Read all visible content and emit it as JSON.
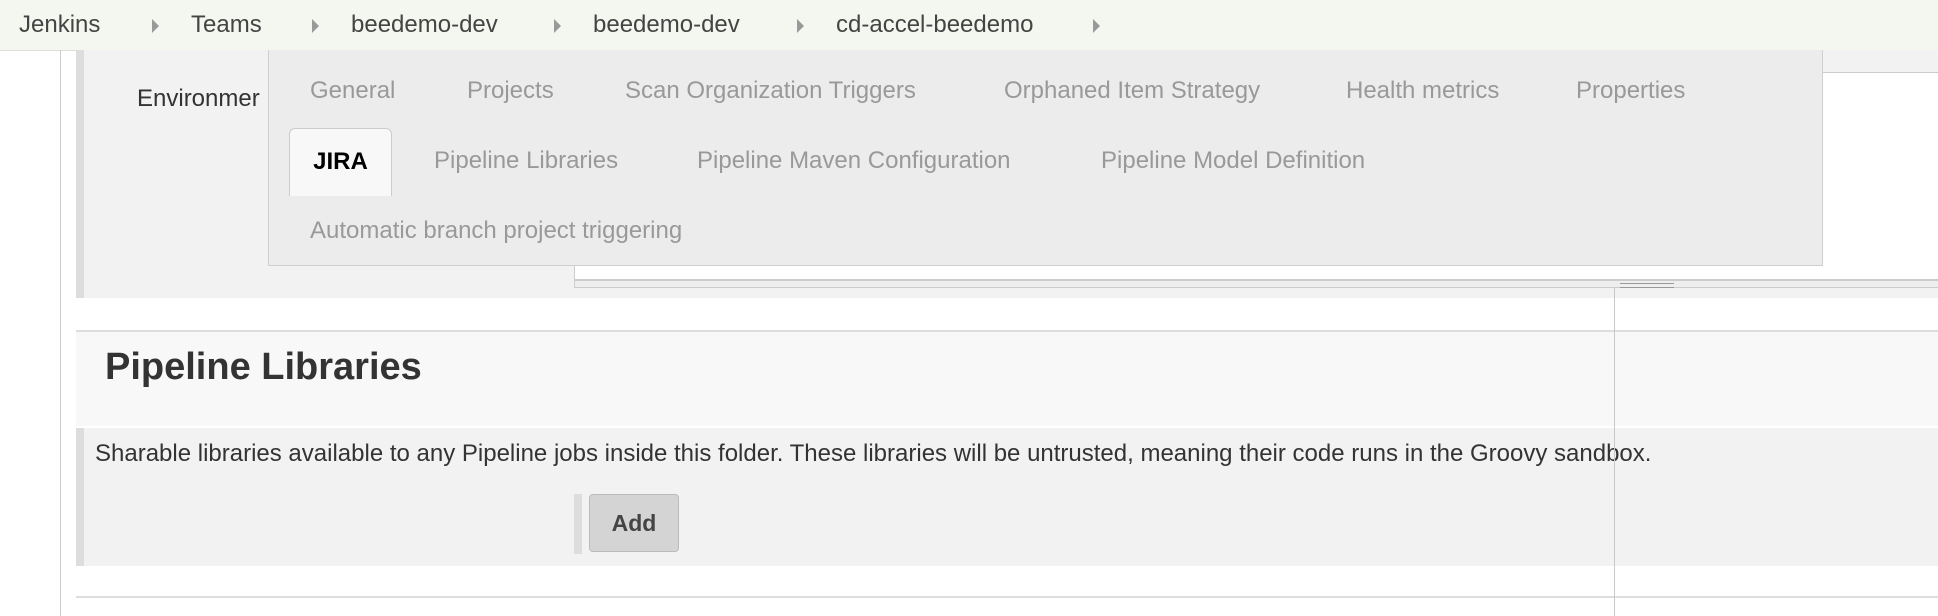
{
  "breadcrumb": {
    "items": [
      {
        "label": "Jenkins"
      },
      {
        "label": "Teams"
      },
      {
        "label": "beedemo-dev"
      },
      {
        "label": "beedemo-dev"
      },
      {
        "label": "cd-accel-beedemo"
      }
    ]
  },
  "environment": {
    "label": "Environmer"
  },
  "tabs": {
    "active": "JIRA",
    "items": [
      {
        "label": "General"
      },
      {
        "label": "Projects"
      },
      {
        "label": "Scan Organization Triggers"
      },
      {
        "label": "Orphaned Item Strategy"
      },
      {
        "label": "Health metrics"
      },
      {
        "label": "Properties"
      },
      {
        "label": "JIRA"
      },
      {
        "label": "Pipeline Libraries"
      },
      {
        "label": "Pipeline Maven Configuration"
      },
      {
        "label": "Pipeline Model Definition"
      },
      {
        "label": "Automatic branch project triggering"
      }
    ]
  },
  "pipeline_libraries": {
    "title": "Pipeline Libraries",
    "description": "Sharable libraries available to any Pipeline jobs inside this folder. These libraries will be untrusted, meaning their code runs in the Groovy sandbox.",
    "add_label": "Add"
  }
}
